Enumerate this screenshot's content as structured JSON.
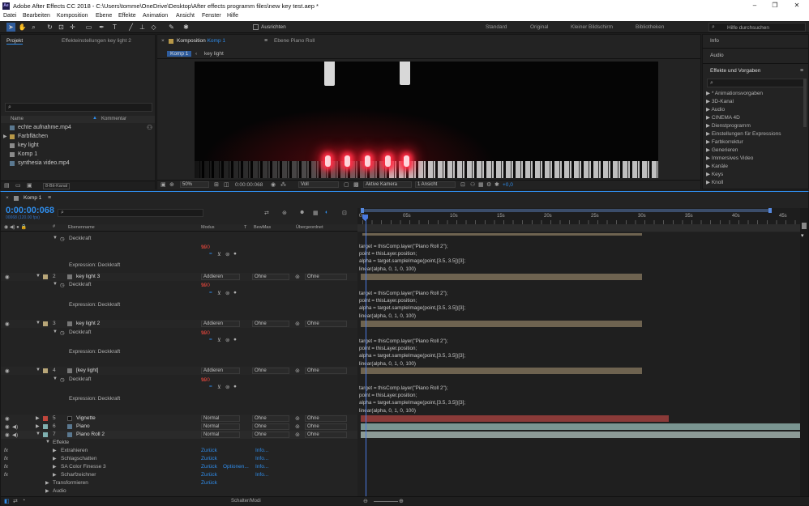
{
  "app": {
    "title": "Adobe After Effects CC 2018 - C:\\Users\\tomme\\OneDrive\\Desktop\\After effects programm files\\new key test.aep *",
    "icon": "Ae"
  },
  "menu": [
    "Datei",
    "Bearbeiten",
    "Komposition",
    "Ebene",
    "Effekte",
    "Animation",
    "Ansicht",
    "Fenster",
    "Hilfe"
  ],
  "toolbar": {
    "snap_label": "Ausrichten",
    "workspaces": [
      "Standard",
      "Original",
      "Kleiner Bildschirm",
      "Bibliotheken"
    ],
    "search_placeholder": "Hilfe durchsuchen"
  },
  "project": {
    "tab": "Projekt",
    "tab2": "Effekteinstellungen key light 2",
    "col_name": "Name",
    "col_comment": "Kommentar",
    "items": [
      "echte aufnahme.mp4",
      "Farbflächen",
      "key light",
      "Komp 1",
      "synthesia video.mp4"
    ],
    "bitdepth": "8-Bit-Kanal"
  },
  "comp": {
    "tab": "Komposition",
    "comp_link": "Komp 1",
    "tab2": "Ebene  Piano Roll",
    "crumb1": "Komp 1",
    "crumb2": "key light",
    "zoom": "50%",
    "timecode": "0:00:00:068",
    "res": "Voll",
    "camera": "Aktive Kamera",
    "views": "1 Ansicht",
    "exposure": "+0,0"
  },
  "right": {
    "info": "Info",
    "audio": "Audio",
    "effects_title": "Effekte und Vorgaben",
    "effects": [
      "* Animationsvorgaben",
      "3D-Kanal",
      "Audio",
      "CINEMA 4D",
      "Dienstprogramm",
      "Einstellungen für Expressions",
      "Farbkorrektur",
      "Generieren",
      "Immersives Video",
      "Kanäle",
      "Keys",
      "Knoll"
    ]
  },
  "timeline": {
    "tab": "Komp 1",
    "timecode": "0:00:00:068",
    "fps": "00068 (120.00 fps)",
    "headers": {
      "name": "Ebenenname",
      "mode": "Modus",
      "t": "T",
      "track": "BewMas",
      "parent": "Übergeordnet"
    },
    "ruler": [
      "0s",
      "05s",
      "10s",
      "15s",
      "20s",
      "25s",
      "30s",
      "35s",
      "40s",
      "45s"
    ],
    "bottom": "Schalter/Modi"
  },
  "labels": {
    "opacity": "Deckkraft",
    "opacity_value": "100",
    "opacity_unit": "%",
    "expression": "Expression: Deckkraft",
    "effects": "Effekte",
    "transform": "Transformieren",
    "audio": "Audio",
    "reset": "Zurück",
    "info": "Info...",
    "options": "Optionen..."
  },
  "layers": [
    {
      "num": "2",
      "name": "key light 3",
      "mode": "Addieren",
      "track": "Ohne",
      "parent": "Ohne"
    },
    {
      "num": "3",
      "name": "key light 2",
      "mode": "Addieren",
      "track": "Ohne",
      "parent": "Ohne"
    },
    {
      "num": "4",
      "name": "[key light]",
      "mode": "Addieren",
      "track": "Ohne",
      "parent": "Ohne"
    },
    {
      "num": "5",
      "name": "Vignette",
      "mode": "Normal",
      "track": "Ohne",
      "parent": "Ohne"
    },
    {
      "num": "6",
      "name": "Piano",
      "mode": "Normal",
      "track": "Ohne",
      "parent": "Ohne"
    },
    {
      "num": "7",
      "name": "Piano Roll 2",
      "mode": "Normal",
      "track": "Ohne",
      "parent": "Ohne"
    }
  ],
  "effects_list": [
    "Extrahieren",
    "Schlagschatten",
    "SA Color Finesse 3",
    "Scharfzeichner"
  ],
  "expression_lines": [
    "target = thisComp.layer(\"Piano Roll 2\");",
    "point = thisLayer.position;",
    "alpha = target.sampleImage(point,[3.5, 3.5])[3];",
    "linear(alpha, 0, 1, 0, 100)"
  ],
  "colors": {
    "accent": "#2f8dec",
    "bar_tan": "#6e6350",
    "bar_red": "#8a3a38",
    "bar_teal": "#7a9591",
    "bar_gray": "#8c9a96"
  }
}
